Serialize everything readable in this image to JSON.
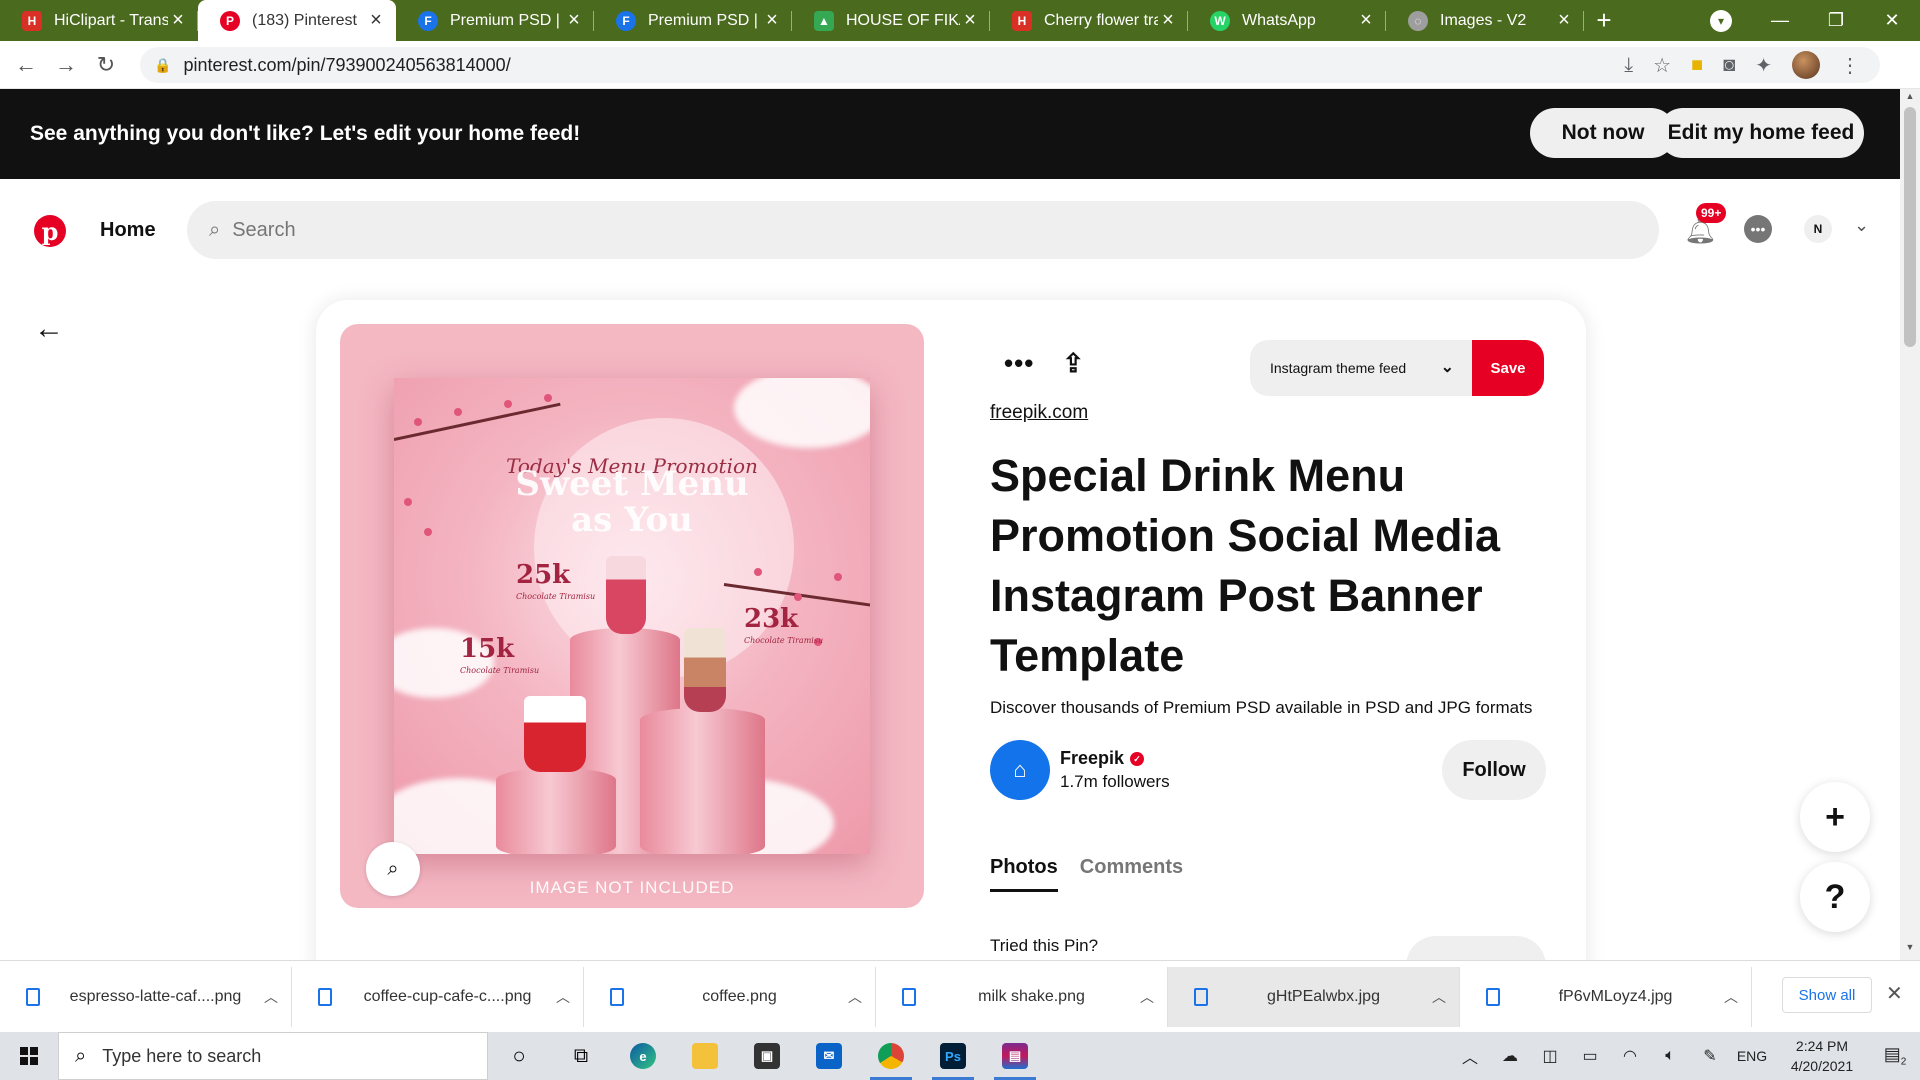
{
  "browser": {
    "tabs": [
      {
        "title": "HiClipart - Transpa",
        "favicon_color": "#d93025",
        "glyph": "H",
        "active": false
      },
      {
        "title": "(183) Pinterest",
        "favicon_color": "#e60023",
        "glyph": "P",
        "active": true
      },
      {
        "title": "Premium PSD | Sp",
        "favicon_color": "#1a73e8",
        "glyph": "F",
        "active": false
      },
      {
        "title": "Premium PSD | Sn",
        "favicon_color": "#1a73e8",
        "glyph": "F",
        "active": false
      },
      {
        "title": "HOUSE OF FIKA -",
        "favicon_color": "#34a853",
        "glyph": "▲",
        "active": false
      },
      {
        "title": "Cherry flower tran",
        "favicon_color": "#d93025",
        "glyph": "H",
        "active": false
      },
      {
        "title": "WhatsApp",
        "favicon_color": "#25d366",
        "glyph": "W",
        "active": false
      },
      {
        "title": "Images - V2",
        "favicon_color": "#9e9e9e",
        "glyph": "◌",
        "active": false
      }
    ],
    "url": "pinterest.com/pin/793900240563814000/"
  },
  "banner": {
    "message": "See anything you don't like? Let's edit your home feed!",
    "not_now": "Not now",
    "edit_feed": "Edit my home feed"
  },
  "header": {
    "home": "Home",
    "search_placeholder": "Search",
    "notif_badge": "99+",
    "avatar_initial": "N"
  },
  "pin": {
    "poster": {
      "script_line": "Today's Menu Promotion",
      "headline_1": "Sweet Menu",
      "headline_2": "as You",
      "price_1": "25k",
      "price_2": "23k",
      "price_3": "15k",
      "item_sub": "Chocolate Tiramisu",
      "watermark": "IMAGE NOT INCLUDED"
    },
    "board": "Instagram theme feed",
    "save": "Save",
    "source": "freepik.com",
    "title": "Special Drink Menu Promotion Social Media Instagram Post Banner Template",
    "description": "Discover thousands of Premium PSD available in PSD and JPG formats",
    "creator": {
      "name": "Freepik",
      "followers": "1.7m followers"
    },
    "follow": "Follow",
    "tabs": [
      "Photos",
      "Comments"
    ],
    "tried": "Tried this Pin?"
  },
  "downloads": {
    "items": [
      {
        "name": "espresso-latte-caf....png",
        "highlighted": false
      },
      {
        "name": "coffee-cup-cafe-c....png",
        "highlighted": false
      },
      {
        "name": "coffee.png",
        "highlighted": false
      },
      {
        "name": "milk shake.png",
        "highlighted": false
      },
      {
        "name": "gHtPEalwbx.jpg",
        "highlighted": true
      },
      {
        "name": "fP6vMLoyz4.jpg",
        "highlighted": false
      }
    ],
    "show_all": "Show all"
  },
  "taskbar": {
    "search_placeholder": "Type here to search",
    "language": "ENG",
    "time": "2:24 PM",
    "date": "4/20/2021",
    "notif_count": "2"
  },
  "colors": {
    "pinterest_red": "#e60023",
    "tabstrip": "#4a6a1e",
    "banner_bg": "#111111",
    "freepik_blue": "#1273eb"
  }
}
